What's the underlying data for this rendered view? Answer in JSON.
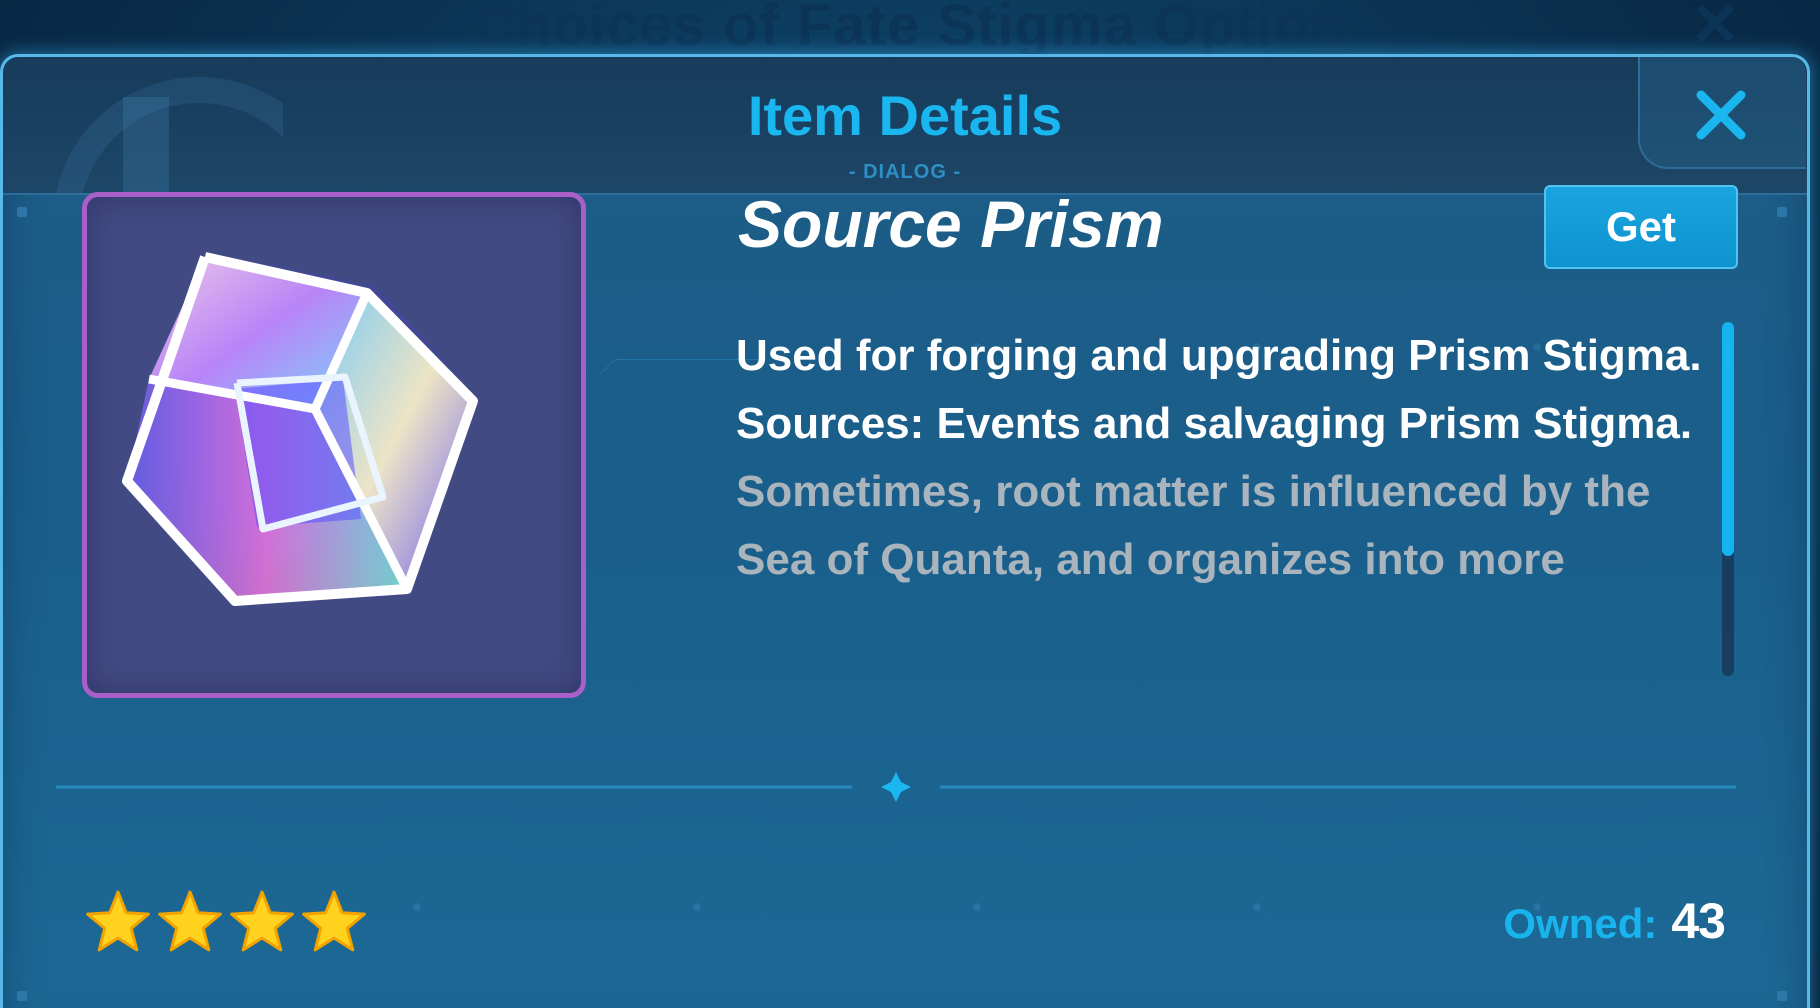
{
  "background": {
    "title": "Choices of Fate Stigma Option"
  },
  "dialog": {
    "title": "Item Details",
    "subtitle": "- DIALOG -",
    "close_icon": "close-icon"
  },
  "item": {
    "name": "Source Prism",
    "image_icon": "prism-cube-icon",
    "get_label": "Get",
    "description": "Used for forging and upgrading Prism Stigma. Sources: Events and salvaging Prism Stigma.",
    "flavor_text": "Sometimes, root matter is influenced by the Sea of Quanta, and organizes into more",
    "rarity_stars": 4,
    "owned_label": "Owned:",
    "owned_value": "43",
    "description_scroll_fraction": 0.66
  },
  "colors": {
    "accent": "#19b6f0",
    "frame_purple": "#a860c8",
    "star": "#ffd21e"
  }
}
